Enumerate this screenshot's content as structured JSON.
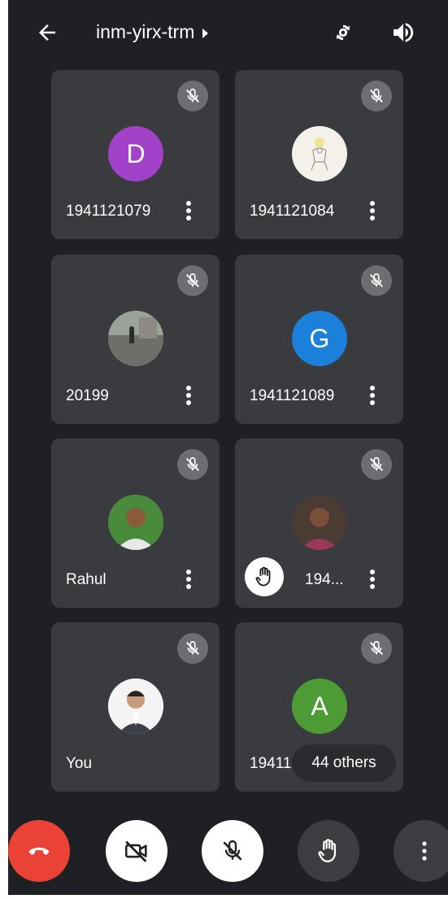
{
  "meeting": {
    "title": "inm-yirx-trm"
  },
  "icons": {
    "back": "arrow-left-icon",
    "switch_camera": "switch-camera-icon",
    "speaker": "speaker-icon",
    "mic_off": "mic-off-icon",
    "more": "more-vert-icon",
    "hand": "raise-hand-icon",
    "end_call": "end-call-icon",
    "camera_off": "camera-off-icon"
  },
  "colors": {
    "background": "#1f2023",
    "tile": "#3a3b3e",
    "end_call": "#ea4335",
    "avatar_d": "#a142c8",
    "avatar_g": "#1a80d9",
    "avatar_a": "#4d9b34"
  },
  "participants": [
    {
      "name": "1941121079",
      "avatar_initial": "D",
      "muted": true
    },
    {
      "name": "1941121084",
      "avatar_initial": "",
      "muted": true
    },
    {
      "name": "20199",
      "avatar_initial": "",
      "muted": true
    },
    {
      "name": "1941121089",
      "avatar_initial": "G",
      "muted": true
    },
    {
      "name": "Rahul",
      "avatar_initial": "",
      "muted": true
    },
    {
      "name": "194...",
      "avatar_initial": "",
      "muted": true,
      "hand_raised": true
    },
    {
      "name": "You",
      "avatar_initial": "",
      "muted": true
    },
    {
      "name": "19411",
      "avatar_initial": "A",
      "muted": true
    }
  ],
  "others": {
    "label": "44 others"
  }
}
